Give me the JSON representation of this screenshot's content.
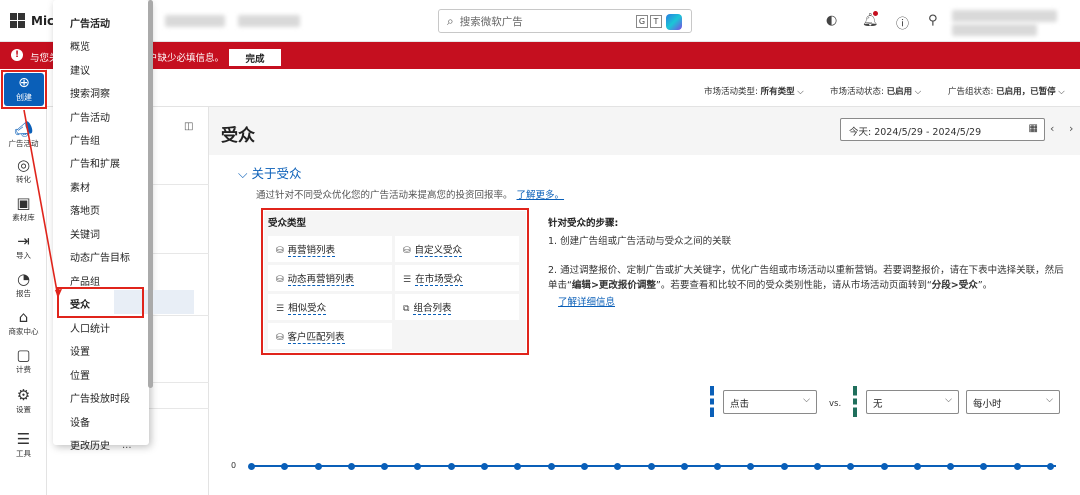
{
  "topbar": {
    "logo_text": "Micr",
    "search_placeholder": "搜索微软广告",
    "kbd_keys": [
      "G",
      "T"
    ]
  },
  "banner": {
    "text_left": "与您关",
    "text_right": "户缺少必填信息。",
    "done_label": "完成"
  },
  "filters": {
    "type_label": "市场活动类型:",
    "type_value": "所有类型",
    "status_label": "市场活动状态:",
    "status_value": "已启用",
    "adgroup_label": "广告组状态:",
    "adgroup_value": "已启用，已暂停"
  },
  "rail": {
    "create": "创建",
    "items": [
      "广告活动",
      "转化",
      "素材库",
      "导入",
      "报告",
      "商家中心",
      "计费",
      "设置",
      "工具"
    ]
  },
  "menu": {
    "header": "广告活动",
    "items": [
      "概览",
      "建议",
      "搜索洞察",
      "广告活动",
      "广告组",
      "广告和扩展",
      "素材",
      "落地页",
      "关键词",
      "动态广告目标",
      "产品组",
      "受众",
      "人口统计",
      "设置",
      "位置",
      "广告投放时段",
      "设备",
      "更改历史"
    ],
    "selected": "受众",
    "more": "..."
  },
  "main": {
    "title": "受众",
    "date_range": "今天: 2024/5/29 - 2024/5/29",
    "about_title": "关于受众",
    "description": "通过针对不同受众优化您的广告活动来提高您的投资回报率。",
    "learn_more": "了解更多。",
    "audience_types_header": "受众类型",
    "audience_types": [
      {
        "label": "再营销列表",
        "icon": "remarketing-icon"
      },
      {
        "label": "自定义受众",
        "icon": "custom-audience-icon"
      },
      {
        "label": "动态再营销列表",
        "icon": "dynamic-remarketing-icon"
      },
      {
        "label": "在市场受众",
        "icon": "in-market-icon"
      },
      {
        "label": "相似受众",
        "icon": "similar-audience-icon"
      },
      {
        "label": "组合列表",
        "icon": "combined-list-icon"
      },
      {
        "label": "客户匹配列表",
        "icon": "customer-match-icon"
      }
    ],
    "steps_header": "针对受众的步骤:",
    "step1": "1. 创建广告组或广告活动与受众之间的关联",
    "step2_a": "2. 通过调整报价、定制广告或扩大关键字，优化广告组或市场活动以重新营销。若要调整报价，请在下表中选择关联，然后单击“",
    "step2_b": "编辑",
    "step2_c": ">",
    "step2_d": "更改报价调整",
    "step2_e": "”。若要查看和比较不同的受众类别性能，请从市场活动页面转到“",
    "step2_f": "分段",
    "step2_g": ">",
    "step2_h": "受众",
    "step2_i": "”。",
    "learn_details": "了解详细信息"
  },
  "chart_controls": {
    "metric1": "点击",
    "vs": "vs.",
    "metric2": "无",
    "granularity": "每小时",
    "zero_label": "0"
  },
  "chart_data": {
    "type": "line",
    "series": [
      {
        "values": [
          0,
          0,
          0,
          0,
          0,
          0,
          0,
          0,
          0,
          0,
          0,
          0,
          0,
          0,
          0,
          0,
          0,
          0,
          0,
          0,
          0,
          0,
          0,
          0,
          0
        ]
      }
    ]
  },
  "colors": {
    "accent": "#0a5fb8",
    "banner": "#c50f1f",
    "highlight": "#e0241b"
  }
}
